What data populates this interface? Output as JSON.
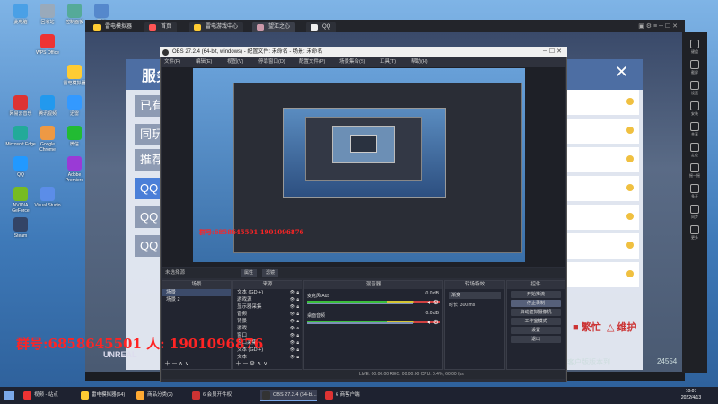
{
  "desktop_icons": [
    {
      "label": "此电脑",
      "color": "#4aa0e6"
    },
    {
      "label": "回收站",
      "color": "#9ab"
    },
    {
      "label": "控制面板",
      "color": "#5a9"
    },
    {
      "label": "网络",
      "color": "#58c"
    },
    {
      "label": "WPS Office",
      "color": "#e33"
    },
    {
      "label": "雷电模拟器",
      "color": "#fc3"
    },
    {
      "label": "网易云音乐",
      "color": "#d33"
    },
    {
      "label": "腾讯视频",
      "color": "#29e"
    },
    {
      "label": "迅雷",
      "color": "#39f"
    },
    {
      "label": "Microsoft Edge",
      "color": "#2a9"
    },
    {
      "label": "Google Chrome",
      "color": "#e94"
    },
    {
      "label": "微信",
      "color": "#2b3"
    },
    {
      "label": "QQ",
      "color": "#29f"
    },
    {
      "label": "Adobe Premiere",
      "color": "#9a3ad6"
    },
    {
      "label": "NVIDIA GeForce",
      "color": "#7b2"
    },
    {
      "label": "Visual Studio",
      "color": "#5b8de8"
    },
    {
      "label": "Steam",
      "color": "#346"
    }
  ],
  "emulator": {
    "tabs": [
      "雷电模拟器",
      "首页",
      "雷电游戏中心",
      "望江之心",
      "QQ"
    ],
    "right_buttons": [
      "键盘",
      "截屏",
      "设置",
      "安装",
      "共享",
      "定位",
      "摇一摇",
      "多开",
      "同步",
      "更多"
    ]
  },
  "game": {
    "panel_title": "服务",
    "close": "✕",
    "left_items": [
      "已有",
      "同玩",
      "推荐",
      "QQ",
      "QQ",
      "QQ"
    ],
    "right_labels": [
      "繁忙",
      "维护"
    ],
    "footer": "客户版版本到",
    "footer_num": "24554",
    "unreal": "UNREAL"
  },
  "obs": {
    "title": "OBS 27.2.4 (64-bit, windows) - 配置文件: 未命名 - 场景: 未命名",
    "menu": [
      "文件(F)",
      "编辑(E)",
      "视图(V)",
      "停靠窗口(D)",
      "配置文件(P)",
      "场景集合(S)",
      "工具(T)",
      "帮助(H)"
    ],
    "scene_bar_label": "未选择源",
    "scene_props": [
      "属性",
      "滤镜"
    ],
    "docks": {
      "scenes": {
        "title": "场景",
        "items": [
          "场景",
          "场景 2"
        ]
      },
      "sources": {
        "title": "来源",
        "items": [
          "文本 (GDI+)",
          "游戏源",
          "显示器采集",
          "音频",
          "背景",
          "游戏",
          "窗口",
          "窗口采集",
          "文本 (GDI+)",
          "文本"
        ]
      },
      "mixer": {
        "title": "混音器",
        "tracks": [
          {
            "name": "麦克风/Aux",
            "db": "-0.0 dB"
          },
          {
            "name": "桌面音频",
            "db": "0.0 dB"
          }
        ]
      },
      "transitions": {
        "title": "转场特效",
        "type": "渐变",
        "duration_label": "时长",
        "duration": "300 ms"
      },
      "controls": {
        "title": "控件",
        "buttons": [
          "开始推流",
          "停止录制",
          "启动虚拟摄像机",
          "工作室模式",
          "设置",
          "退出"
        ]
      }
    },
    "status": "LIVE: 00:00:00   REC: 00:00:00   CPU: 0.4%, 60.00 fps"
  },
  "watermark": {
    "text": "群号:6858645501 人: 1901096876",
    "small": "群号:6858645501  1901096876"
  },
  "taskbar": {
    "items": [
      {
        "label": "视频 - 站点",
        "color": "#e33",
        "active": false
      },
      {
        "label": "雷电模拟器(64)",
        "color": "#fc3",
        "active": false
      },
      {
        "label": "商品分类(2)",
        "color": "#fa3",
        "active": false
      },
      {
        "label": "6 会员开件权",
        "color": "#c33",
        "active": false
      },
      {
        "label": "OBS 27.2.4 (64-bi...",
        "color": "#333",
        "active": true
      },
      {
        "label": "6 商客户端",
        "color": "#d33",
        "active": false
      }
    ],
    "time": "10:07",
    "date": "2022/4/13"
  }
}
